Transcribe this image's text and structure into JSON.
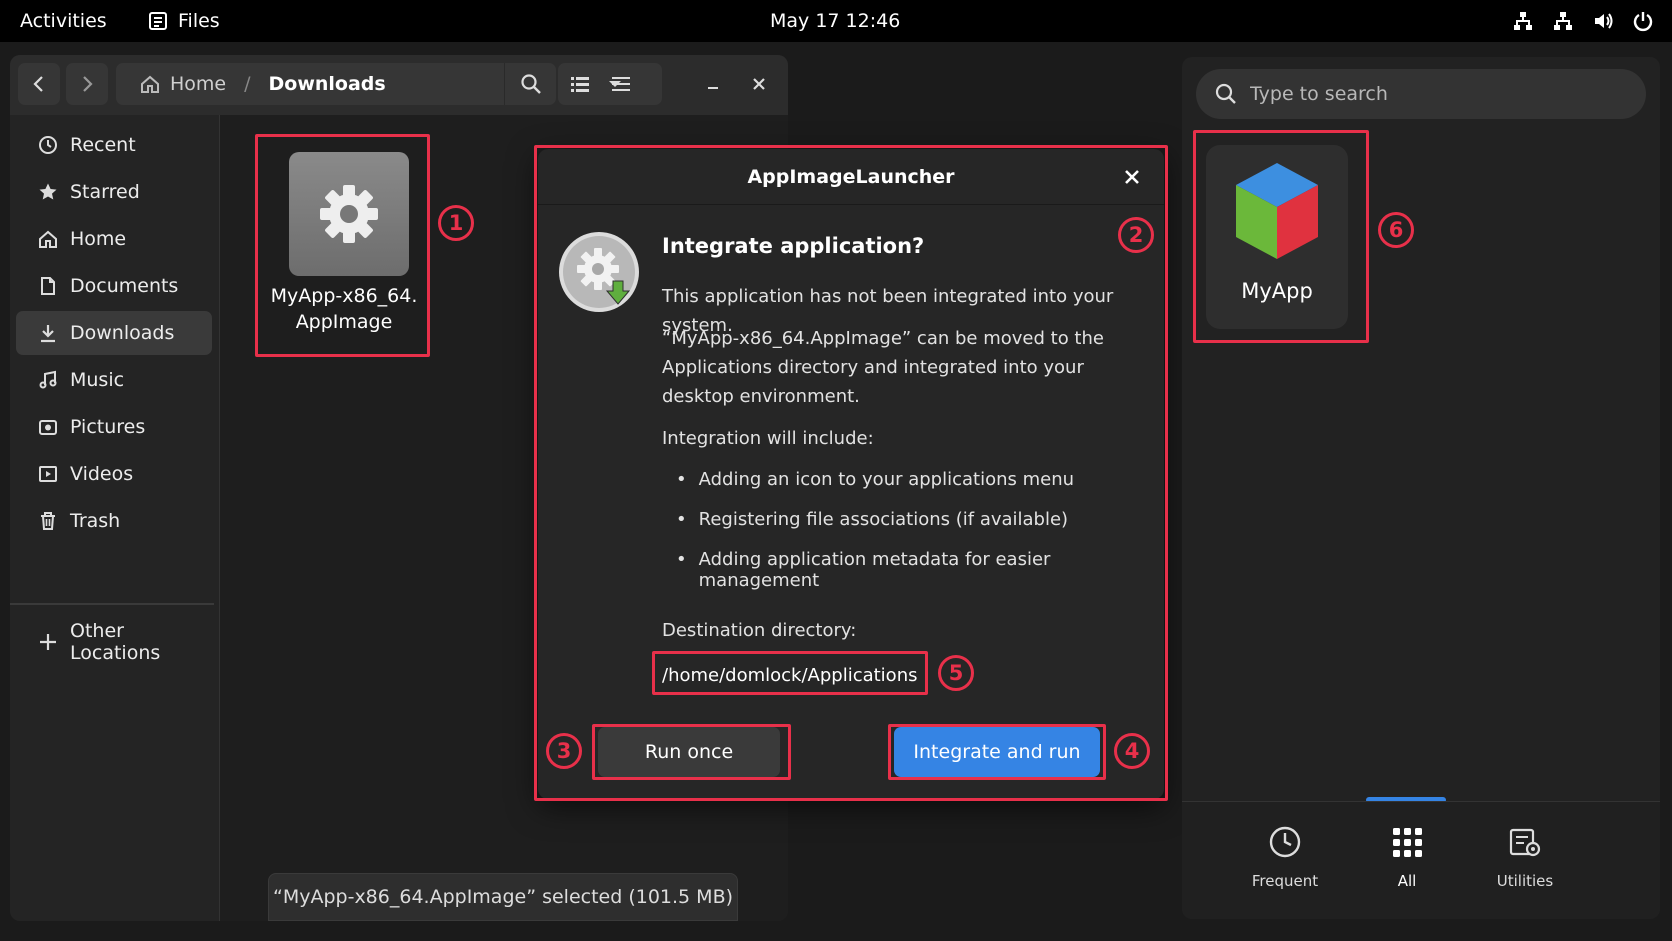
{
  "topbar": {
    "activities": "Activities",
    "app_name": "Files",
    "clock": "May 17  12:46"
  },
  "file_manager": {
    "path_home": "Home",
    "path_separator": "/",
    "path_current": "Downloads",
    "sidebar": [
      {
        "label": "Recent",
        "icon": "clock-icon"
      },
      {
        "label": "Starred",
        "icon": "star-icon"
      },
      {
        "label": "Home",
        "icon": "home-icon"
      },
      {
        "label": "Documents",
        "icon": "document-icon"
      },
      {
        "label": "Downloads",
        "icon": "download-icon",
        "active": true
      },
      {
        "label": "Music",
        "icon": "music-icon"
      },
      {
        "label": "Pictures",
        "icon": "camera-icon"
      },
      {
        "label": "Videos",
        "icon": "video-icon"
      },
      {
        "label": "Trash",
        "icon": "trash-icon"
      }
    ],
    "other_locations": "Other Locations",
    "file": {
      "name_line1": "MyApp-x86_64.",
      "name_line2": "AppImage"
    },
    "status": "“MyApp-x86_64.AppImage” selected  (101.5 MB)"
  },
  "dialog": {
    "title": "AppImageLauncher",
    "heading": "Integrate application?",
    "line1": "This application has not been integrated into your system.",
    "para2_line1": "“MyApp-x86_64.AppImage” can be moved to the",
    "para2_line2": "Applications directory and integrated into your",
    "para2_line3": "desktop environment.",
    "include_label": "Integration will include:",
    "bullets": [
      "Adding an icon to your applications menu",
      "Registering file associations (if available)",
      "Adding application metadata for easier management"
    ],
    "destination_label": "Destination directory:",
    "destination_value": "/home/domlock/Applications",
    "run_once": "Run once",
    "integrate_and_run": "Integrate and run"
  },
  "overview": {
    "search_placeholder": "Type to search",
    "app_name": "MyApp",
    "categories": [
      {
        "label": "Frequent",
        "icon": "clock-icon"
      },
      {
        "label": "All",
        "icon": "grid-icon"
      },
      {
        "label": "Utilities",
        "icon": "utilities-icon"
      }
    ]
  },
  "annotations": [
    "1",
    "2",
    "3",
    "4",
    "5",
    "6"
  ],
  "colors": {
    "accent": "#3584e4",
    "annotation": "#e8304a"
  }
}
